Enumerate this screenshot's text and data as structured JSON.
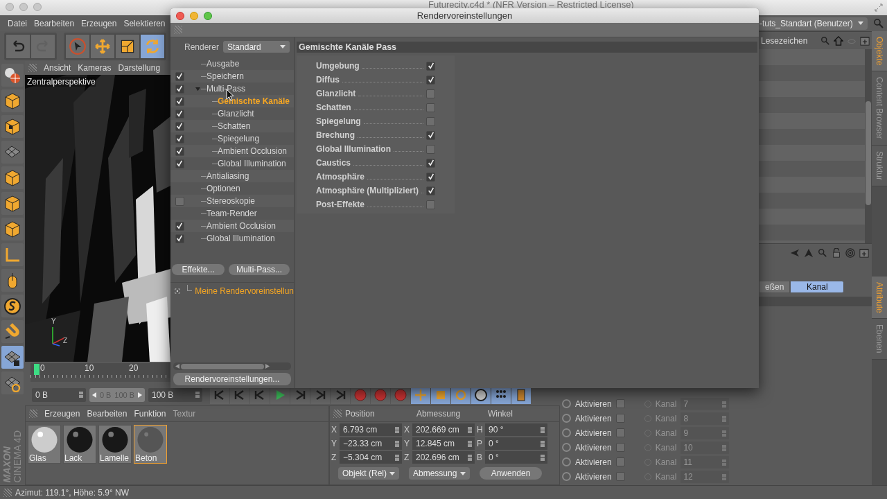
{
  "main_window": {
    "title": "Futurecity.c4d * (NFR Version – Restricted License)"
  },
  "menu": [
    "Datei",
    "Bearbeiten",
    "Erzeugen",
    "Selektieren"
  ],
  "layout_selector": "-tuts_Standart (Benutzer)",
  "toolbar": {
    "history": [
      {
        "kind": "undo",
        "disabled": false
      },
      {
        "kind": "redo",
        "disabled": true
      }
    ],
    "tools": [
      {
        "kind": "select",
        "selected": false
      },
      {
        "kind": "move",
        "selected": false
      },
      {
        "kind": "scale",
        "selected": false
      },
      {
        "kind": "rotate",
        "selected": true
      }
    ]
  },
  "viewport": {
    "menu": [
      "Ansicht",
      "Kameras",
      "Darstellung"
    ],
    "camera": "Zentralperspektive",
    "axis_labels": [
      "Y",
      "Z"
    ]
  },
  "timeline": {
    "ticks": [
      "0",
      "10",
      "20"
    ]
  },
  "frame_fields": {
    "start": "0 B",
    "range_start": "0 B",
    "range_end": "100 B",
    "end": "100 B"
  },
  "material_manager": {
    "menu": [
      "Erzeugen",
      "Bearbeiten",
      "Funktion",
      "Textur"
    ],
    "materials": [
      {
        "name": "Glas",
        "kind": "glass",
        "selected": false
      },
      {
        "name": "Lack",
        "kind": "gloss",
        "selected": false
      },
      {
        "name": "Lamelle",
        "kind": "gloss",
        "selected": false
      },
      {
        "name": "Beton",
        "kind": "matte",
        "selected": true
      }
    ]
  },
  "coordinates": {
    "headers": [
      "Position",
      "Abmessung",
      "Winkel"
    ],
    "rows": [
      {
        "cells": [
          {
            "axis": "X",
            "value": "6.793 cm"
          },
          {
            "axis": "X",
            "value": "202.669 cm"
          },
          {
            "axis": "H",
            "value": "90 °"
          }
        ]
      },
      {
        "cells": [
          {
            "axis": "Y",
            "value": "−23.33 cm"
          },
          {
            "axis": "Y",
            "value": "12.845 cm"
          },
          {
            "axis": "P",
            "value": "0 °"
          }
        ]
      },
      {
        "cells": [
          {
            "axis": "Z",
            "value": "−5.304 cm"
          },
          {
            "axis": "Z",
            "value": "202.696 cm"
          },
          {
            "axis": "B",
            "value": "0 °"
          }
        ]
      }
    ],
    "mode_dropdowns": [
      "Objekt (Rel)",
      "Abmessung"
    ],
    "apply_button": "Anwenden"
  },
  "attribute_rows": [
    {
      "label": "Aktivieren",
      "checked": false,
      "channel_label": "Kanal",
      "channel": "7",
      "disabled": true
    },
    {
      "label": "Aktivieren",
      "checked": false,
      "channel_label": "Kanal",
      "channel": "8",
      "disabled": true
    },
    {
      "label": "Aktivieren",
      "checked": false,
      "channel_label": "Kanal",
      "channel": "9",
      "disabled": true
    },
    {
      "label": "Aktivieren",
      "checked": false,
      "channel_label": "Kanal",
      "channel": "10",
      "disabled": true
    },
    {
      "label": "Aktivieren",
      "checked": false,
      "channel_label": "Kanal",
      "channel": "11",
      "disabled": true
    },
    {
      "label": "Aktivieren",
      "checked": false,
      "channel_label": "Kanal",
      "channel": "12",
      "disabled": true
    }
  ],
  "object_manager": {
    "menu_item": "Lesezeichen"
  },
  "attribute_tabs": [
    {
      "label": "eßen",
      "selected": false
    },
    {
      "label": "Kanal",
      "selected": true
    }
  ],
  "side_tabs_top": [
    {
      "label": "Objekte",
      "selected": true
    },
    {
      "label": "Content Browser",
      "selected": false
    },
    {
      "label": "Struktur",
      "selected": false
    }
  ],
  "side_tabs_bottom": [
    {
      "label": "Attribute",
      "selected": true
    },
    {
      "label": "Ebenen",
      "selected": false
    }
  ],
  "status_bar": "Azimut: 119.1°, Höhe: 5.9°  NW",
  "logo": [
    "MAXON",
    "CINEMA 4D"
  ],
  "dialog": {
    "title": "Rendervoreinstellungen",
    "renderer_label": "Renderer",
    "renderer": "Standard",
    "tree": [
      {
        "label": "Ausgabe",
        "selected": false
      },
      {
        "label": "Speichern",
        "checked": true,
        "selected": false
      },
      {
        "label": "Multi-Pass",
        "checked": true,
        "selected": false,
        "expanded": true,
        "children": [
          {
            "label": "Gemischte Kanäle",
            "checked": true,
            "selected": true
          },
          {
            "label": "Glanzlicht",
            "checked": true,
            "selected": false
          },
          {
            "label": "Schatten",
            "checked": true,
            "selected": false
          },
          {
            "label": "Spiegelung",
            "checked": true,
            "selected": false
          },
          {
            "label": "Ambient Occlusion",
            "checked": true,
            "selected": false
          },
          {
            "label": "Global Illumination",
            "checked": true,
            "selected": false
          }
        ]
      },
      {
        "label": "Antialiasing",
        "selected": false
      },
      {
        "label": "Optionen",
        "selected": false
      },
      {
        "label": "Stereoskopie",
        "checked": false,
        "selected": false
      },
      {
        "label": "Team-Render",
        "selected": false
      },
      {
        "label": "Ambient Occlusion",
        "checked": true,
        "selected": false
      },
      {
        "label": "Global Illumination",
        "checked": true,
        "selected": false
      }
    ],
    "buttons": [
      "Effekte...",
      "Multi-Pass..."
    ],
    "presets": [
      {
        "label": "Meine Rendervoreinstellun",
        "selected": true
      }
    ],
    "settings_button": "Rendervoreinstellungen...",
    "panel_title": "Gemischte Kanäle Pass",
    "options": [
      {
        "label": "Umgebung",
        "checked": true
      },
      {
        "label": "Diffus",
        "checked": true
      },
      {
        "label": "Glanzlicht",
        "checked": false
      },
      {
        "label": "Schatten",
        "checked": false
      },
      {
        "label": "Spiegelung",
        "checked": false
      },
      {
        "label": "Brechung",
        "checked": true
      },
      {
        "label": "Global Illumination",
        "checked": false
      },
      {
        "label": "Caustics",
        "checked": true
      },
      {
        "label": "Atmosphäre",
        "checked": true
      },
      {
        "label": "Atmosphäre (Multipliziert)",
        "checked": true
      },
      {
        "label": "Post-Effekte",
        "checked": false
      }
    ]
  }
}
